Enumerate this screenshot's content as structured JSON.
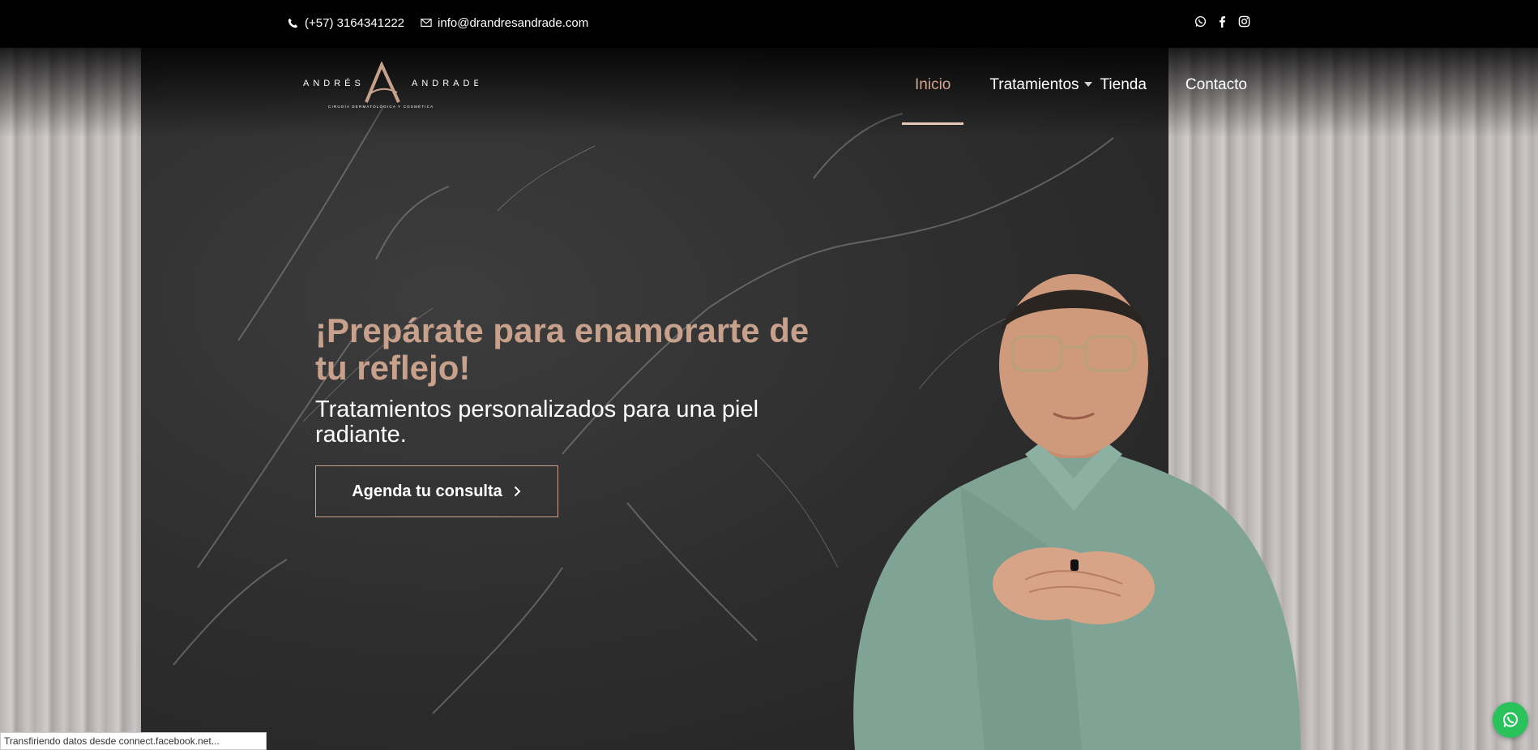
{
  "topbar": {
    "phone": "(+57) 3164341222",
    "email": "info@drandresandrade.com",
    "social": [
      "whatsapp-icon",
      "facebook-icon",
      "instagram-icon"
    ]
  },
  "logo": {
    "first_name": "ANDRÉS",
    "last_name": "ANDRADE",
    "monogram": "A",
    "tagline": "CIRUGÍA DERMATOLÓGICA Y COSMÉTICA"
  },
  "nav": {
    "items": [
      {
        "label": "Inicio",
        "active": true
      },
      {
        "label": "Tratamientos",
        "active": false,
        "has_dropdown": true
      },
      {
        "label": "Tienda",
        "active": false
      },
      {
        "label": "Contacto",
        "active": false
      }
    ]
  },
  "hero": {
    "title": "¡Prepárate para enamorarte de tu reflejo!",
    "subtitle": "Tratamientos personalizados para una piel radiante.",
    "cta_label": "Agenda tu consulta"
  },
  "status_bar": {
    "text": "Transfiriendo datos desde connect.facebook.net..."
  },
  "colors": {
    "accent": "#c8a18c",
    "nav_active": "#d1a590",
    "underline": "#e8c8b6",
    "topbar": "#000000",
    "whatsapp": "#2ac25a"
  }
}
